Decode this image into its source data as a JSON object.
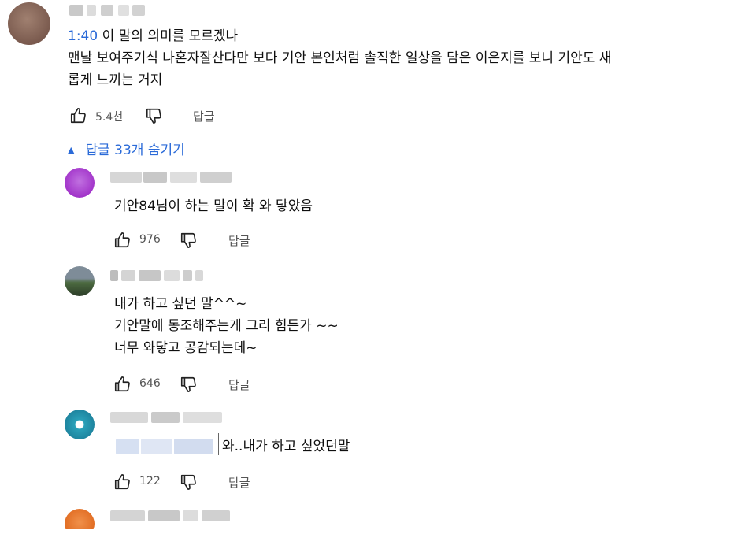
{
  "top_comment": {
    "timestamp": "1:40",
    "line1_rest": " 이 말의 의미를 모르겠나",
    "line2": "맨날 보여주기식 나혼자잘산다만 보다 기안 본인처럼 솔직한 일상을 담은 이은지를 보니 기안도 새",
    "line3": "롭게 느끼는 거지",
    "likes": "5.4천",
    "reply_label": "답글"
  },
  "replies_toggle": "답글 33개 숨기기",
  "replies": [
    {
      "lines": [
        "기안84님이 하는 말이 확 와 닿았음"
      ],
      "likes": "976",
      "reply_label": "답글"
    },
    {
      "lines": [
        "내가 하고 싶던 말^^~",
        "기안말에 동조해주는게 그리 힘든가 ~~",
        "너무 와닿고 공감되는데~"
      ],
      "likes": "646",
      "reply_label": "답글"
    },
    {
      "lines": [
        "와..내가 하고 싶었던말"
      ],
      "likes": "122",
      "reply_label": "답글"
    }
  ],
  "colors": {
    "accent": "#2a6ad8",
    "avatar_top": "#8a6a5c",
    "avatar_1": "#b040d0",
    "avatar_2": "#5a7050",
    "avatar_3": "#2aa0b8",
    "avatar_4": "#e8782a"
  },
  "icons": [
    "thumbs-up-icon",
    "thumbs-down-icon",
    "caret-up-icon"
  ]
}
